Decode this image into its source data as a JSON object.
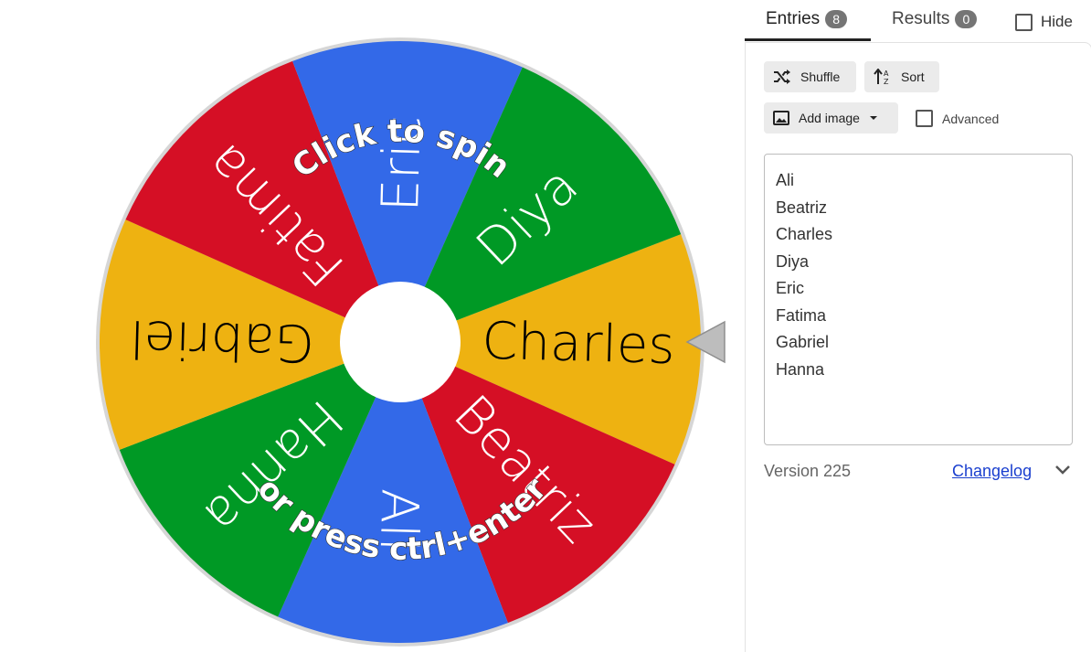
{
  "wheel": {
    "segments": [
      {
        "label": "Charles",
        "color": "#eeb211"
      },
      {
        "label": "Beatriz",
        "color": "#d50f25"
      },
      {
        "label": "Ali",
        "color": "#3369e8"
      },
      {
        "label": "Hanna",
        "color": "#009925"
      },
      {
        "label": "Gabriel",
        "color": "#eeb211"
      },
      {
        "label": "Fatima",
        "color": "#d50f25"
      },
      {
        "label": "Eric",
        "color": "#3369e8"
      },
      {
        "label": "Diya",
        "color": "#009925"
      }
    ],
    "spin_text_top": "Click to spin",
    "spin_text_bottom": "or press ctrl+enter"
  },
  "tabs": {
    "entries_label": "Entries",
    "entries_count": "8",
    "results_label": "Results",
    "results_count": "0",
    "hide_label": "Hide"
  },
  "toolbar": {
    "shuffle_label": "Shuffle",
    "sort_label": "Sort",
    "add_image_label": "Add image",
    "advanced_label": "Advanced"
  },
  "entries": [
    "Ali",
    "Beatriz",
    "Charles",
    "Diya",
    "Eric",
    "Fatima",
    "Gabriel",
    "Hanna"
  ],
  "footer": {
    "version": "Version 225",
    "changelog": "Changelog"
  }
}
